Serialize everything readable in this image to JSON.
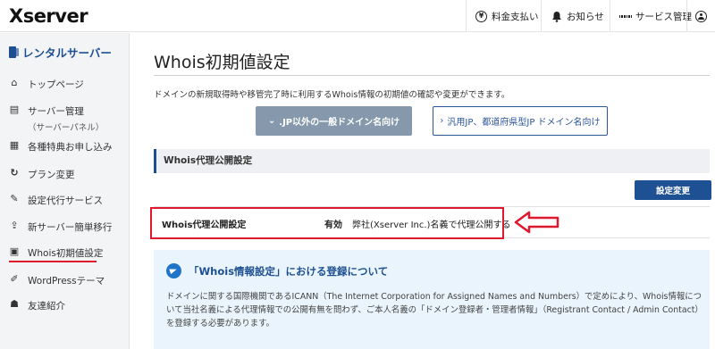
{
  "header": {
    "logo": "Xserver",
    "billing_label": "料金支払い",
    "notice_label": "お知らせ",
    "service_label": "サービス管理"
  },
  "sidebar": {
    "title": "レンタルサーバー",
    "items": [
      {
        "label": "トップページ",
        "icon": "home-icon"
      },
      {
        "label": "サーバー管理",
        "sub": "（サーバーパネル）",
        "icon": "server-icon"
      },
      {
        "label": "各種特典お申し込み",
        "icon": "gift-icon"
      },
      {
        "label": "プラン変更",
        "icon": "refresh-icon"
      },
      {
        "label": "設定代行サービス",
        "icon": "wrench-icon"
      },
      {
        "label": "新サーバー簡単移行",
        "icon": "upload-icon"
      },
      {
        "label": "Whois初期値設定",
        "icon": "document-icon",
        "active": true
      },
      {
        "label": "WordPressテーマ",
        "icon": "edit-icon"
      },
      {
        "label": "友達紹介",
        "icon": "person-icon"
      }
    ]
  },
  "main": {
    "title": "Whois初期値設定",
    "lead": "ドメインの新規取得時や移管完了時に利用するWhois情報の初期値の確認や変更ができます。",
    "tabs": [
      {
        "label": ".JP以外の一般ドメイン名向け",
        "active": true
      },
      {
        "label": "汎用JP、都道府県型JP ドメイン名向け",
        "active": false
      }
    ],
    "section_title": "Whois代理公開設定",
    "edit_button": "設定変更",
    "row": {
      "label": "Whois代理公開設定",
      "status": "有効",
      "value": "弊社(Xserver Inc.)名義で代理公開する"
    },
    "info": {
      "title": "「Whois情報設定」における登録について",
      "text": "ドメインに関する国際機関であるICANN（The Internet Corporation for Assigned Names and Numbers）で定めにより、Whois情報について当社名義による代理情報での公開有無を問わず、ご本人名義の「ドメイン登録者・管理者情報」（Registrant Contact / Admin Contact）を登録する必要があります。"
    }
  },
  "colors": {
    "brand": "#1d4f91",
    "highlight": "#e0182d",
    "tab_active": "#8699ac",
    "info_bg": "#eaf4fc"
  }
}
